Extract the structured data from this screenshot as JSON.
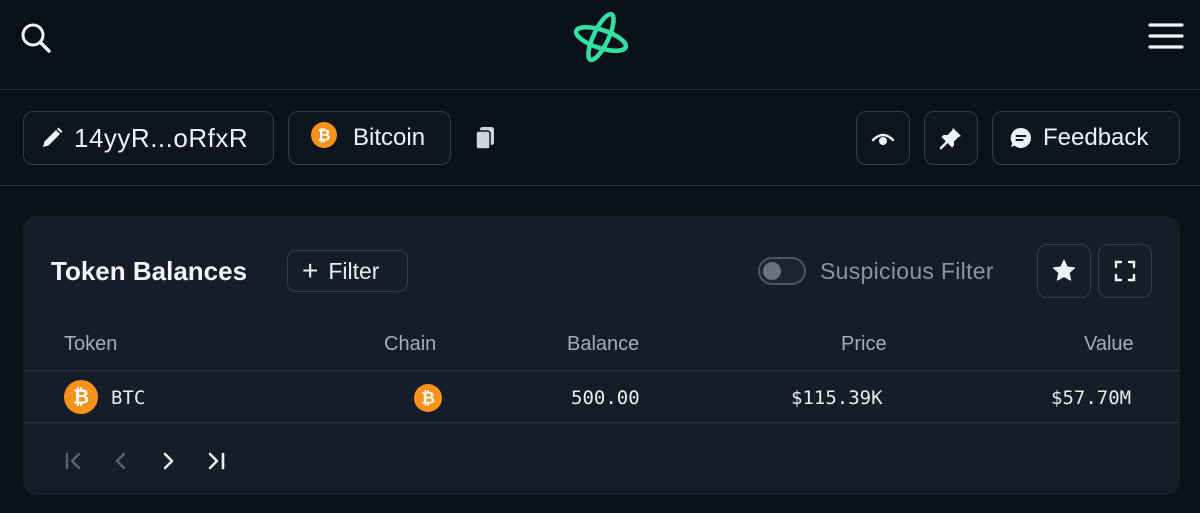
{
  "header": {
    "search_icon": "search-icon",
    "logo_icon": "logo-icon",
    "menu_icon": "hamburger-menu-icon"
  },
  "toolbar": {
    "address": "14yyR...oRfxR",
    "chain": "Bitcoin",
    "feedback": "Feedback"
  },
  "colors": {
    "background": "#0b1119",
    "card": "#151d29",
    "accent_logo": "#34e0a1",
    "bitcoin_orange": "#f7931a"
  },
  "token_balances": {
    "title": "Token Balances",
    "filter_label": "Filter",
    "suspicious_filter_label": "Suspicious Filter",
    "suspicious_filter_on": false,
    "columns": [
      "Token",
      "Chain",
      "Balance",
      "Price",
      "Value"
    ],
    "rows": [
      {
        "token": "BTC",
        "chain": "Bitcoin",
        "balance": "500.00",
        "price": "$115.39K",
        "value": "$57.70M"
      }
    ]
  }
}
